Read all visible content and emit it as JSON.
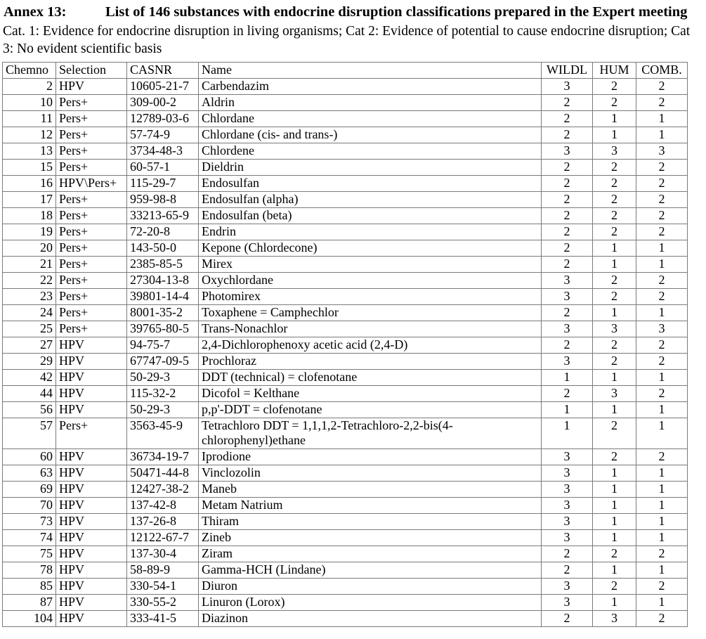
{
  "heading": {
    "label": "Annex 13:",
    "title": "List of 146 substances with endocrine disruption classifications prepared in the Expert meeting"
  },
  "subtitle": "Cat. 1: Evidence for endocrine disruption in living organisms; Cat 2: Evidence of potential to cause endocrine disruption; Cat 3: No evident scientific basis",
  "table": {
    "columns": [
      {
        "key": "chemno",
        "label": "Chemno"
      },
      {
        "key": "selection",
        "label": "Selection"
      },
      {
        "key": "casnr",
        "label": "CASNR"
      },
      {
        "key": "name",
        "label": "Name"
      },
      {
        "key": "wildl",
        "label": "WILDL"
      },
      {
        "key": "hum",
        "label": "HUM"
      },
      {
        "key": "comb",
        "label": "COMB."
      }
    ],
    "rows": [
      {
        "chemno": "2",
        "selection": "HPV",
        "casnr": "10605-21-7",
        "name": "Carbendazim",
        "wildl": "3",
        "hum": "2",
        "comb": "2"
      },
      {
        "chemno": "10",
        "selection": "Pers+",
        "casnr": "309-00-2",
        "name": "Aldrin",
        "wildl": "2",
        "hum": "2",
        "comb": "2"
      },
      {
        "chemno": "11",
        "selection": "Pers+",
        "casnr": "12789-03-6",
        "name": "Chlordane",
        "wildl": "2",
        "hum": "1",
        "comb": "1"
      },
      {
        "chemno": "12",
        "selection": "Pers+",
        "casnr": "57-74-9",
        "name": "Chlordane (cis- and trans-)",
        "wildl": "2",
        "hum": "1",
        "comb": "1"
      },
      {
        "chemno": "13",
        "selection": "Pers+",
        "casnr": "3734-48-3",
        "name": "Chlordene",
        "wildl": "3",
        "hum": "3",
        "comb": "3"
      },
      {
        "chemno": "15",
        "selection": "Pers+",
        "casnr": "60-57-1",
        "name": "Dieldrin",
        "wildl": "2",
        "hum": "2",
        "comb": "2"
      },
      {
        "chemno": "16",
        "selection": "HPV\\Pers+",
        "casnr": "115-29-7",
        "name": "Endosulfan",
        "wildl": "2",
        "hum": "2",
        "comb": "2"
      },
      {
        "chemno": "17",
        "selection": "Pers+",
        "casnr": "959-98-8",
        "name": "Endosulfan (alpha)",
        "wildl": "2",
        "hum": "2",
        "comb": "2"
      },
      {
        "chemno": "18",
        "selection": "Pers+",
        "casnr": "33213-65-9",
        "name": "Endosulfan (beta)",
        "wildl": "2",
        "hum": "2",
        "comb": "2"
      },
      {
        "chemno": "19",
        "selection": "Pers+",
        "casnr": "72-20-8",
        "name": "Endrin",
        "wildl": "2",
        "hum": "2",
        "comb": "2"
      },
      {
        "chemno": "20",
        "selection": "Pers+",
        "casnr": "143-50-0",
        "name": "Kepone (Chlordecone)",
        "wildl": "2",
        "hum": "1",
        "comb": "1"
      },
      {
        "chemno": "21",
        "selection": "Pers+",
        "casnr": "2385-85-5",
        "name": "Mirex",
        "wildl": "2",
        "hum": "1",
        "comb": "1"
      },
      {
        "chemno": "22",
        "selection": "Pers+",
        "casnr": "27304-13-8",
        "name": "Oxychlordane",
        "wildl": "3",
        "hum": "2",
        "comb": "2"
      },
      {
        "chemno": "23",
        "selection": "Pers+",
        "casnr": "39801-14-4",
        "name": "Photomirex",
        "wildl": "3",
        "hum": "2",
        "comb": "2"
      },
      {
        "chemno": "24",
        "selection": "Pers+",
        "casnr": "8001-35-2",
        "name": "Toxaphene = Camphechlor",
        "wildl": "2",
        "hum": "1",
        "comb": "1"
      },
      {
        "chemno": "25",
        "selection": "Pers+",
        "casnr": "39765-80-5",
        "name": "Trans-Nonachlor",
        "wildl": "3",
        "hum": "3",
        "comb": "3"
      },
      {
        "chemno": "27",
        "selection": "HPV",
        "casnr": "94-75-7",
        "name": "2,4-Dichlorophenoxy acetic acid (2,4-D)",
        "wildl": "2",
        "hum": "2",
        "comb": "2"
      },
      {
        "chemno": "29",
        "selection": "HPV",
        "casnr": "67747-09-5",
        "name": "Prochloraz",
        "wildl": "3",
        "hum": "2",
        "comb": "2"
      },
      {
        "chemno": "42",
        "selection": "HPV",
        "casnr": "50-29-3",
        "name": "DDT (technical) = clofenotane",
        "wildl": "1",
        "hum": "1",
        "comb": "1"
      },
      {
        "chemno": "44",
        "selection": "HPV",
        "casnr": "115-32-2",
        "name": "Dicofol = Kelthane",
        "wildl": "2",
        "hum": "3",
        "comb": "2"
      },
      {
        "chemno": "56",
        "selection": "HPV",
        "casnr": "50-29-3",
        "name": "p,p'-DDT = clofenotane",
        "wildl": "1",
        "hum": "1",
        "comb": "1"
      },
      {
        "chemno": "57",
        "selection": "Pers+",
        "casnr": "3563-45-9",
        "name": "Tetrachloro DDT = 1,1,1,2-Tetrachloro-2,2-bis(4-chlorophenyl)ethane",
        "wildl": "1",
        "hum": "2",
        "comb": "1",
        "tall": true
      },
      {
        "chemno": "60",
        "selection": "HPV",
        "casnr": "36734-19-7",
        "name": "Iprodione",
        "wildl": "3",
        "hum": "2",
        "comb": "2"
      },
      {
        "chemno": "63",
        "selection": "HPV",
        "casnr": "50471-44-8",
        "name": "Vinclozolin",
        "wildl": "3",
        "hum": "1",
        "comb": "1"
      },
      {
        "chemno": "69",
        "selection": "HPV",
        "casnr": "12427-38-2",
        "name": "Maneb",
        "wildl": "3",
        "hum": "1",
        "comb": "1"
      },
      {
        "chemno": "70",
        "selection": "HPV",
        "casnr": "137-42-8",
        "name": "Metam Natrium",
        "wildl": "3",
        "hum": "1",
        "comb": "1"
      },
      {
        "chemno": "73",
        "selection": "HPV",
        "casnr": "137-26-8",
        "name": "Thiram",
        "wildl": "3",
        "hum": "1",
        "comb": "1"
      },
      {
        "chemno": "74",
        "selection": "HPV",
        "casnr": "12122-67-7",
        "name": "Zineb",
        "wildl": "3",
        "hum": "1",
        "comb": "1"
      },
      {
        "chemno": "75",
        "selection": "HPV",
        "casnr": "137-30-4",
        "name": "Ziram",
        "wildl": "2",
        "hum": "2",
        "comb": "2"
      },
      {
        "chemno": "78",
        "selection": "HPV",
        "casnr": "58-89-9",
        "name": "Gamma-HCH (Lindane)",
        "wildl": "2",
        "hum": "1",
        "comb": "1"
      },
      {
        "chemno": "85",
        "selection": "HPV",
        "casnr": "330-54-1",
        "name": "Diuron",
        "wildl": "3",
        "hum": "2",
        "comb": "2"
      },
      {
        "chemno": "87",
        "selection": "HPV",
        "casnr": "330-55-2",
        "name": "Linuron (Lorox)",
        "wildl": "3",
        "hum": "1",
        "comb": "1"
      },
      {
        "chemno": "104",
        "selection": "HPV",
        "casnr": "333-41-5",
        "name": "Diazinon",
        "wildl": "2",
        "hum": "3",
        "comb": "2"
      }
    ]
  }
}
